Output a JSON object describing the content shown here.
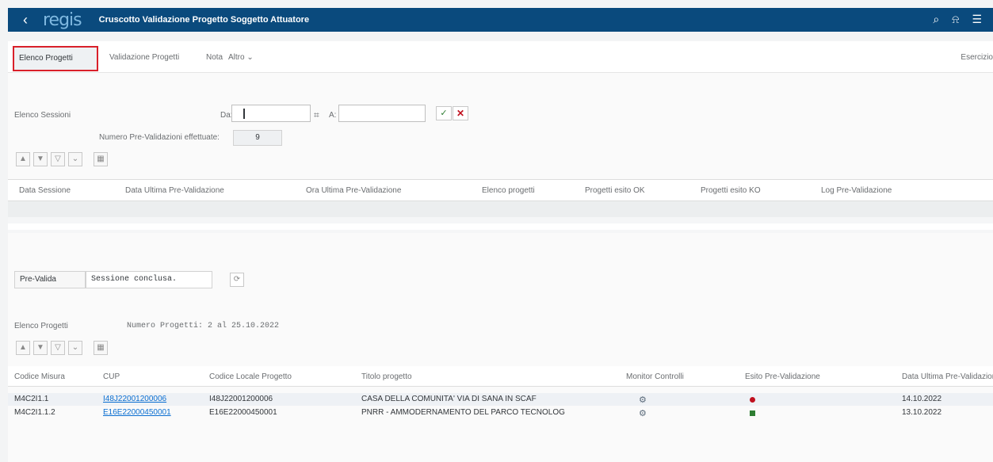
{
  "shell": {
    "back": "‹",
    "logo": "regis",
    "title": "Cruscotto Validazione Progetto Soggetto Attuatore"
  },
  "toolbar": {
    "tabs": [
      "Elenco Progetti",
      "Validazione Progetti",
      "Nota",
      "Altro"
    ],
    "altro_suffix": "⌄",
    "right": "Esercizio"
  },
  "filter": {
    "label": "Elenco Sessioni",
    "da_label": "Da:",
    "a_label": "A:",
    "count_label": "Numero Pre-Validazioni effettuate:",
    "count_value": "9"
  },
  "sessions_table": {
    "headers": [
      "Data Sessione",
      "Data Ultima Pre-Validazione",
      "Ora Ultima Pre-Validazione",
      "Elenco progetti",
      "Progetti esito OK",
      "Progetti esito KO",
      "Log Pre-Validazione"
    ]
  },
  "status": {
    "button": "Pre-Valida",
    "value": "Sessione conclusa."
  },
  "projects": {
    "label": "Elenco Progetti",
    "summary": "Numero Progetti: 2 al 25.10.2022"
  },
  "projects_table": {
    "headers": [
      "Codice Misura",
      "CUP",
      "Codice Locale Progetto",
      "Titolo progetto",
      "Monitor Controlli",
      "Esito Pre-Validazione",
      "Data Ultima Pre-Validazione"
    ],
    "rows": [
      {
        "misura": "M4C2I1.1",
        "cup": "I48J22001200006",
        "codice": "I48J22001200006",
        "titolo": "CASA DELLA COMUNITA' VIA DI SANA IN SCAF",
        "data": "14.10.2022",
        "esito": "red"
      },
      {
        "misura": "M4C2I1.1.2",
        "cup": "E16E22000450001",
        "codice": "E16E22000450001",
        "titolo": "PNRR - AMMODERNAMENTO DEL PARCO TECNOLOG",
        "data": "13.10.2022",
        "esito": "green"
      }
    ]
  },
  "colors": {
    "shell": "#0a4a7d",
    "highlight": "#d9202a",
    "ko": "#c0101e",
    "ok": "#2e7d32"
  }
}
